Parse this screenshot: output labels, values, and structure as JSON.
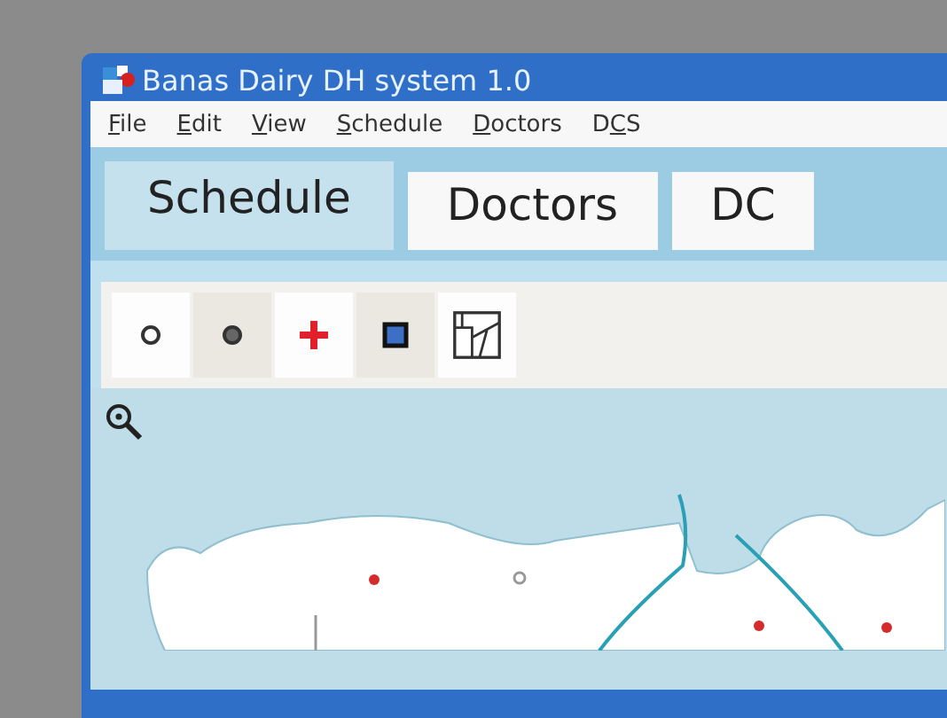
{
  "window": {
    "title": "Banas Dairy DH system 1.0"
  },
  "menu": [
    {
      "key": "F",
      "after": "ile"
    },
    {
      "key": "E",
      "after": "dit"
    },
    {
      "key": "V",
      "after": "iew"
    },
    {
      "key": "S",
      "after": "chedule"
    },
    {
      "key": "D",
      "after": "octors"
    },
    {
      "before": "D",
      "key": "C",
      "after": "S"
    }
  ],
  "tabs": [
    {
      "label": "Schedule",
      "selected": true
    },
    {
      "label": "Doctors",
      "selected": false
    },
    {
      "label": "DC",
      "selected": false
    }
  ],
  "toolbar": [
    {
      "kind": "hollow-circle"
    },
    {
      "kind": "filled-circle"
    },
    {
      "kind": "cross"
    },
    {
      "kind": "square"
    },
    {
      "kind": "map"
    }
  ]
}
